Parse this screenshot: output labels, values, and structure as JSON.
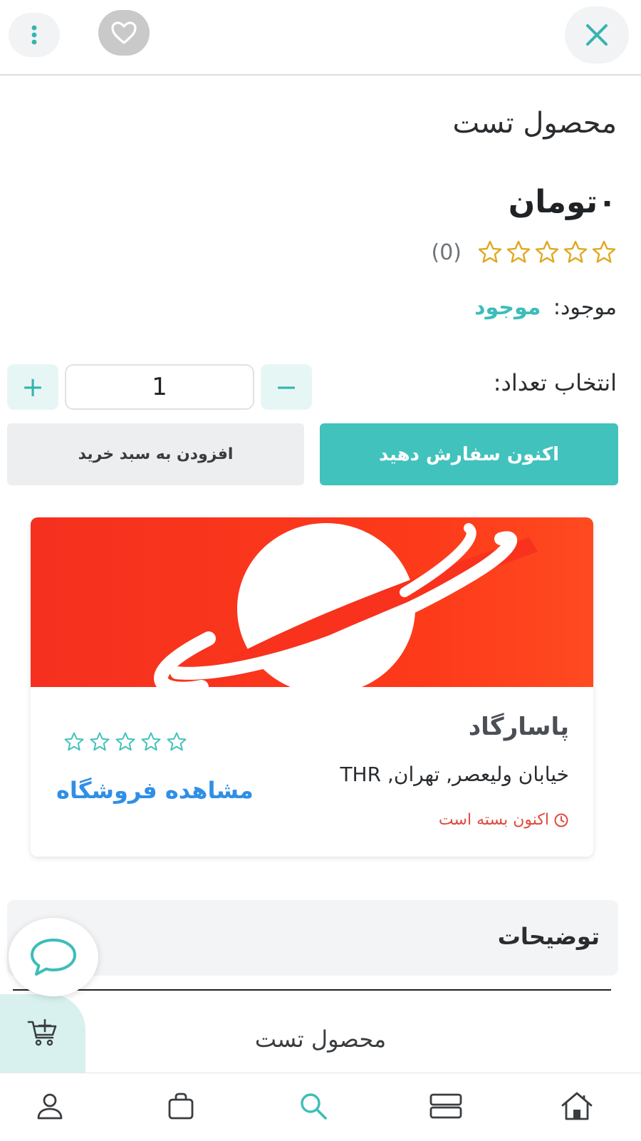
{
  "header": {
    "close_icon": "close-icon",
    "favorite_icon": "heart-icon",
    "more_icon": "more-vertical-icon"
  },
  "product": {
    "title": "محصول تست",
    "price": "۰تومان",
    "rating": {
      "stars": 5,
      "filled": 0,
      "count_text": "(0)"
    },
    "stock": {
      "label": "موجود:",
      "value": "موجود"
    }
  },
  "quantity": {
    "label": "انتخاب تعداد:",
    "value": "1",
    "minus": "−",
    "plus": "+"
  },
  "actions": {
    "order_now": "اکنون سفارش دهید",
    "add_to_cart": "افزودن به سبد خرید"
  },
  "shop": {
    "name": "پاسارگاد",
    "address": "خیابان ولیعصر, تهران, THR",
    "status": "اکنون بسته است",
    "stars": 5,
    "view_link": "مشاهده فروشگاه"
  },
  "description": {
    "title": "توضیحات"
  },
  "cart_strip": {
    "product_name": "محصول تست"
  },
  "bottom_nav": [
    {
      "name": "profile",
      "icon": "user-icon"
    },
    {
      "name": "orders",
      "icon": "shopping-bag-icon"
    },
    {
      "name": "search",
      "icon": "search-icon"
    },
    {
      "name": "categories",
      "icon": "list-icon"
    },
    {
      "name": "home",
      "icon": "home-icon"
    }
  ],
  "colors": {
    "accent": "#41c2bd",
    "link": "#2f8fe6",
    "closed_status": "#e04a3b",
    "star_gold": "#e0a81e",
    "banner_red": "#f5301f"
  }
}
